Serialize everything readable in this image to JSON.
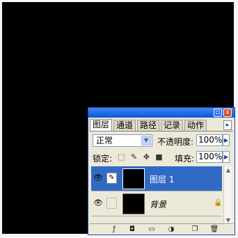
{
  "panel": {
    "tabs": [
      "图层",
      "通道",
      "路径",
      "记录",
      "动作"
    ],
    "tab_menu_icon": "▸",
    "window_buttons": {
      "minimize": "▫",
      "close": "x"
    }
  },
  "blend": {
    "mode": "正常",
    "opacity_label": "不透明度:",
    "opacity_value": "100%"
  },
  "lock": {
    "label": "锁定:",
    "fill_label": "填充:",
    "fill_value": "100%"
  },
  "layers": [
    {
      "name": "图层 1",
      "selected": true,
      "visible": true
    },
    {
      "name": "背景",
      "selected": false,
      "visible": true,
      "locked": true
    }
  ],
  "bottom_icons": [
    "link-icon",
    "layer-style-icon",
    "mask-icon",
    "folder-icon",
    "adjustment-icon",
    "new-layer-icon",
    "trash-icon"
  ]
}
